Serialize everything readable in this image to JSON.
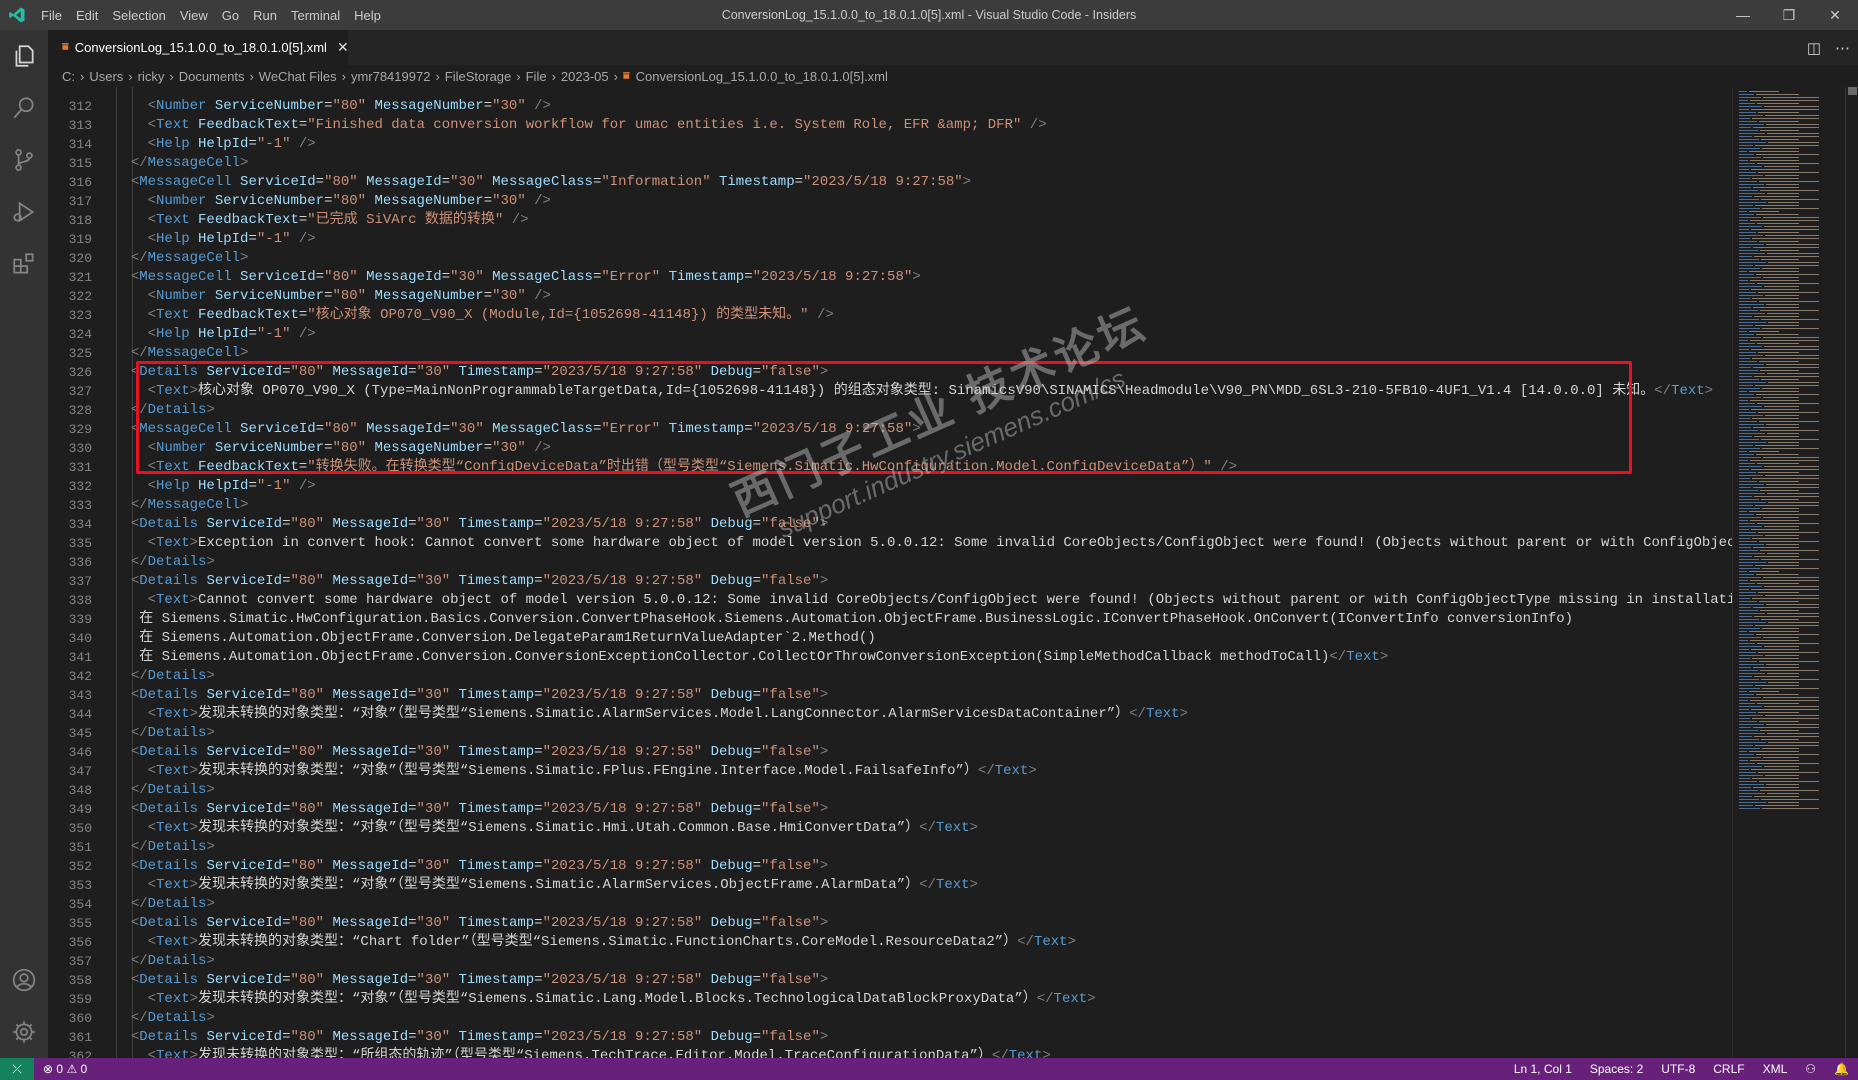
{
  "titlebar": {
    "menus": [
      "File",
      "Edit",
      "Selection",
      "View",
      "Go",
      "Run",
      "Terminal",
      "Help"
    ],
    "title": "ConversionLog_15.1.0.0_to_18.0.1.0[5].xml - Visual Studio Code - Insiders"
  },
  "tab": {
    "label": "ConversionLog_15.1.0.0_to_18.0.1.0[5].xml",
    "close": "✕"
  },
  "breadcrumb": [
    "C:",
    "Users",
    "ricky",
    "Documents",
    "WeChat Files",
    "ymr78419972",
    "FileStorage",
    "File",
    "2023-05",
    "ConversionLog_15.1.0.0_to_18.0.1.0[5].xml"
  ],
  "editor": {
    "first_line": 312,
    "lines": [
      "    <Number ServiceNumber=\"80\" MessageNumber=\"30\" />",
      "    <Text FeedbackText=\"Finished data conversion workflow for umac entities i.e. System Role, EFR &amp; DFR\" />",
      "    <Help HelpId=\"-1\" />",
      "  </MessageCell>",
      "  <MessageCell ServiceId=\"80\" MessageId=\"30\" MessageClass=\"Information\" Timestamp=\"2023/5/18 9:27:58\">",
      "    <Number ServiceNumber=\"80\" MessageNumber=\"30\" />",
      "    <Text FeedbackText=\"已完成 SiVArc 数据的转换\" />",
      "    <Help HelpId=\"-1\" />",
      "  </MessageCell>",
      "  <MessageCell ServiceId=\"80\" MessageId=\"30\" MessageClass=\"Error\" Timestamp=\"2023/5/18 9:27:58\">",
      "    <Number ServiceNumber=\"80\" MessageNumber=\"30\" />",
      "    <Text FeedbackText=\"核心对象 OP070_V90_X (Module,Id={1052698-41148}) 的类型未知。\" />",
      "    <Help HelpId=\"-1\" />",
      "  </MessageCell>",
      "  <Details ServiceId=\"80\" MessageId=\"30\" Timestamp=\"2023/5/18 9:27:58\" Debug=\"false\">",
      "    <Text>核心对象 OP070_V90_X (Type=MainNonProgrammableTargetData,Id={1052698-41148}) 的组态对象类型: SinamicsV90\\SINAMICS\\Headmodule\\V90_PN\\MDD_6SL3-210-5FB10-4UF1_V1.4 [14.0.0.0] 未知。</Text>",
      "  </Details>",
      "  <MessageCell ServiceId=\"80\" MessageId=\"30\" MessageClass=\"Error\" Timestamp=\"2023/5/18 9:27:58\">",
      "    <Number ServiceNumber=\"80\" MessageNumber=\"30\" />",
      "    <Text FeedbackText=\"转换失败。在转换类型“ConfigDeviceData”时出错（型号类型“Siemens.Simatic.HwConfiguration.Model.ConfigDeviceData”）\" />",
      "    <Help HelpId=\"-1\" />",
      "  </MessageCell>",
      "  <Details ServiceId=\"80\" MessageId=\"30\" Timestamp=\"2023/5/18 9:27:58\" Debug=\"false\">",
      "    <Text>Exception in convert hook: Cannot convert some hardware object of model version 5.0.0.12: Some invalid CoreObjects/ConfigObject were found! (Objects without parent or with ConfigObjectType missing in",
      "  </Details>",
      "  <Details ServiceId=\"80\" MessageId=\"30\" Timestamp=\"2023/5/18 9:27:58\" Debug=\"false\">",
      "    <Text>Cannot convert some hardware object of model version 5.0.0.12: Some invalid CoreObjects/ConfigObject were found! (Objects without parent or with ConfigObjectType missing in installation)!",
      "   在 Siemens.Simatic.HwConfiguration.Basics.Conversion.ConvertPhaseHook.Siemens.Automation.ObjectFrame.BusinessLogic.IConvertPhaseHook.OnConvert(IConvertInfo conversionInfo)",
      "   在 Siemens.Automation.ObjectFrame.Conversion.DelegateParam1ReturnValueAdapter`2.Method()",
      "   在 Siemens.Automation.ObjectFrame.Conversion.ConversionExceptionCollector.CollectOrThrowConversionException(SimpleMethodCallback methodToCall)</Text>",
      "  </Details>",
      "  <Details ServiceId=\"80\" MessageId=\"30\" Timestamp=\"2023/5/18 9:27:58\" Debug=\"false\">",
      "    <Text>发现未转换的对象类型：“对象”（型号类型“Siemens.Simatic.AlarmServices.Model.LangConnector.AlarmServicesDataContainer”）</Text>",
      "  </Details>",
      "  <Details ServiceId=\"80\" MessageId=\"30\" Timestamp=\"2023/5/18 9:27:58\" Debug=\"false\">",
      "    <Text>发现未转换的对象类型：“对象”（型号类型“Siemens.Simatic.FPlus.FEngine.Interface.Model.FailsafeInfo”）</Text>",
      "  </Details>",
      "  <Details ServiceId=\"80\" MessageId=\"30\" Timestamp=\"2023/5/18 9:27:58\" Debug=\"false\">",
      "    <Text>发现未转换的对象类型：“对象”（型号类型“Siemens.Simatic.Hmi.Utah.Common.Base.HmiConvertData”）</Text>",
      "  </Details>",
      "  <Details ServiceId=\"80\" MessageId=\"30\" Timestamp=\"2023/5/18 9:27:58\" Debug=\"false\">",
      "    <Text>发现未转换的对象类型：“对象”（型号类型“Siemens.Simatic.AlarmServices.ObjectFrame.AlarmData”）</Text>",
      "  </Details>",
      "  <Details ServiceId=\"80\" MessageId=\"30\" Timestamp=\"2023/5/18 9:27:58\" Debug=\"false\">",
      "    <Text>发现未转换的对象类型：“Chart folder”（型号类型“Siemens.Simatic.FunctionCharts.CoreModel.ResourceData2”）</Text>",
      "  </Details>",
      "  <Details ServiceId=\"80\" MessageId=\"30\" Timestamp=\"2023/5/18 9:27:58\" Debug=\"false\">",
      "    <Text>发现未转换的对象类型：“对象”（型号类型“Siemens.Simatic.Lang.Model.Blocks.TechnologicalDataBlockProxyData”）</Text>",
      "  </Details>",
      "  <Details ServiceId=\"80\" MessageId=\"30\" Timestamp=\"2023/5/18 9:27:58\" Debug=\"false\">",
      "    <Text>发现未转换的对象类型：“所组态的轨迹”（型号类型“Siemens.TechTrace.Editor.Model.TraceConfigurationData”）</Text>"
    ]
  },
  "watermark": {
    "line1": "西门子工业 技术论坛",
    "line2": "support.industry.siemens.com/cs"
  },
  "statusbar": {
    "remote": "⤫",
    "errors": "0",
    "warnings": "0",
    "position": "Ln 1, Col 1",
    "spaces": "Spaces: 2",
    "encoding": "UTF-8",
    "eol": "CRLF",
    "language": "XML"
  },
  "colors": {
    "statusbar": "#68217a",
    "highlight_box": "#e81123",
    "tag": "#569cd6",
    "attr": "#9cdcfe",
    "string": "#ce9178"
  }
}
